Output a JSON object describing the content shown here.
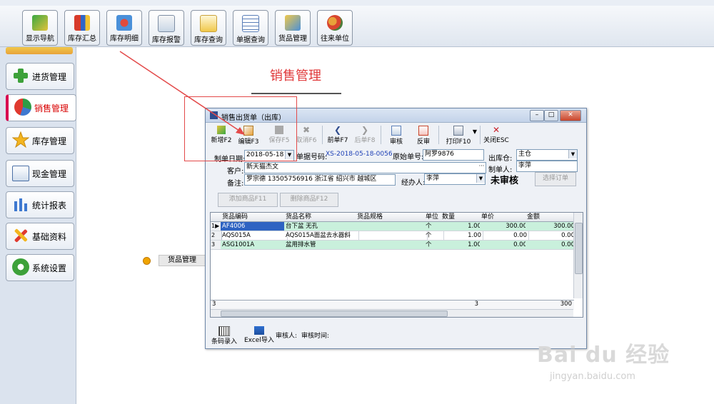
{
  "toolbar": {
    "buttons": [
      {
        "label": "显示导航"
      },
      {
        "label": "库存汇总"
      },
      {
        "label": "库存明细"
      },
      {
        "label": "库存报警"
      },
      {
        "label": "库存查询"
      },
      {
        "label": "单据查询"
      },
      {
        "label": "货品管理"
      },
      {
        "label": "往来单位"
      }
    ]
  },
  "nav": {
    "items": [
      {
        "label": "进货管理",
        "icon": "green-plus-icon"
      },
      {
        "label": "销售管理",
        "icon": "pie-chart-icon",
        "active": true
      },
      {
        "label": "库存管理",
        "icon": "star-icon"
      },
      {
        "label": "现金管理",
        "icon": "cash-icon"
      },
      {
        "label": "统计报表",
        "icon": "bar-chart-icon"
      },
      {
        "label": "基础资料",
        "icon": "tools-icon"
      },
      {
        "label": "系统设置",
        "icon": "gear-icon"
      }
    ]
  },
  "page": {
    "title": "销售管理",
    "side_label": "货品管理"
  },
  "dialog": {
    "title": "销售出货单（出库）",
    "toolbar": [
      {
        "label": "新增F2",
        "icon": "new-icon",
        "enabled": true
      },
      {
        "label": "编辑F3",
        "icon": "edit-icon",
        "enabled": true
      },
      {
        "label": "保存F5",
        "icon": "save-icon",
        "enabled": false
      },
      {
        "label": "取消F6",
        "icon": "cancel-icon",
        "enabled": false
      },
      {
        "label": "前单F7",
        "icon": "prev-icon",
        "enabled": true
      },
      {
        "label": "后单F8",
        "icon": "next-icon",
        "enabled": false
      },
      {
        "label": "审核",
        "icon": "approve-icon",
        "enabled": true
      },
      {
        "label": "反审",
        "icon": "unapprove-icon",
        "enabled": true
      },
      {
        "label": "打印F10",
        "icon": "print-icon",
        "enabled": true
      },
      {
        "label": "关闭ESC",
        "icon": "close-x-icon",
        "enabled": true
      }
    ],
    "form": {
      "date_label": "制单日期:",
      "date_value": "2018-05-18",
      "doc_no_label": "单据号码:",
      "doc_no_value": "XS-2018-05-18-0056",
      "orig_no_label": "原始单号:",
      "orig_no_value": "阿罗9876",
      "warehouse_label": "出库仓:",
      "warehouse_value": "主仓",
      "customer_label": "客户:",
      "customer_value": "新天猫杰文",
      "maker_label": "制单人:",
      "maker_value": "李萍",
      "remark_label": "备注:",
      "remark_value": "罗宗德  13505756916 浙江省  绍兴市  越城区",
      "handler_label": "经办人:",
      "handler_value": "李萍",
      "status": "未审核",
      "select_order_label": "选择订单",
      "add_item_label": "添加商品F11",
      "delete_item_label": "删除商品F12"
    },
    "grid": {
      "columns": [
        "货品编码",
        "货品名称",
        "货品规格",
        "单位",
        "数量",
        "单价",
        "金额"
      ],
      "rows": [
        {
          "no": "1",
          "code": "AF4006",
          "name": "台下盆 无孔",
          "spec": "",
          "unit": "个",
          "qty": "1.00",
          "price": "300.00",
          "amount": "300.00"
        },
        {
          "no": "2",
          "code": "AQS015A",
          "name": "AQS015A面盆去水器斜",
          "spec": "",
          "unit": "个",
          "qty": "1.00",
          "price": "0.00",
          "amount": "0.00"
        },
        {
          "no": "3",
          "code": "ASG1001A",
          "name": "盆用排水管",
          "spec": "",
          "unit": "个",
          "qty": "1.00",
          "price": "0.00",
          "amount": "0.00"
        }
      ],
      "footer": {
        "count": "3",
        "qty_total": "3",
        "amount_total": "300"
      }
    },
    "bottom": {
      "barcode_label": "条码录入",
      "excel_label": "Excel导入",
      "approver_label": "审核人:",
      "approve_time_label": "审核时间:"
    }
  },
  "watermark": {
    "brand": "Bai du 经验",
    "url": "jingyan.baidu.com"
  }
}
